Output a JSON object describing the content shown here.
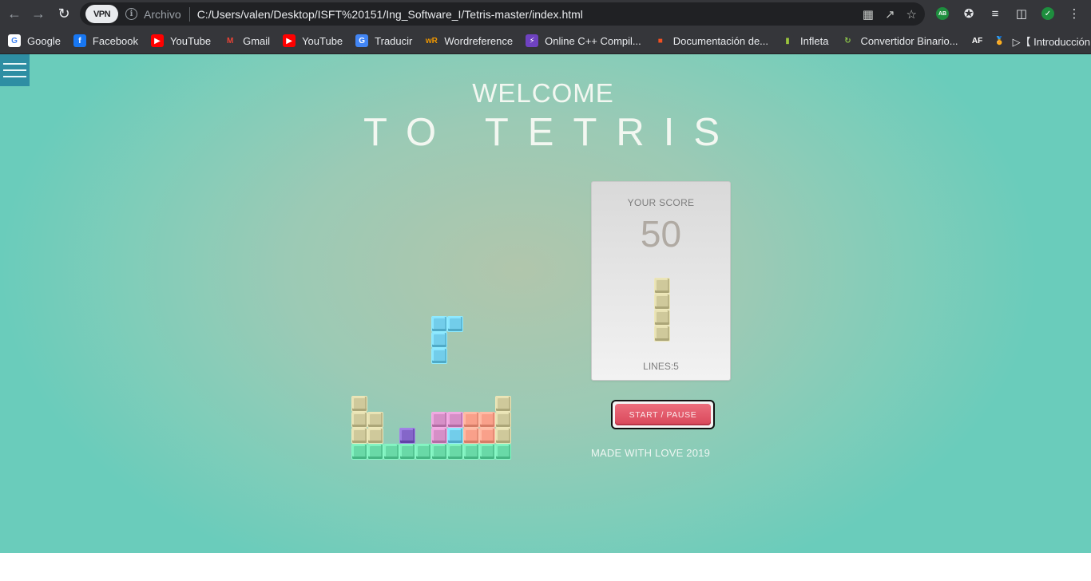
{
  "browser": {
    "vpn_label": "VPN",
    "site_info_label": "Archivo",
    "url": "C:/Users/valen/Desktop/ISFT%20151/Ing_Software_I/Tetris-master/index.html",
    "ext_ab_label": "AB"
  },
  "bookmarks": [
    {
      "label": "Google",
      "icon": "google-icon",
      "color": "#ffffff",
      "glyph": "G",
      "glyph_color": "#4285f4"
    },
    {
      "label": "Facebook",
      "icon": "facebook-icon",
      "color": "#1877f2",
      "glyph": "f",
      "glyph_color": "#ffffff"
    },
    {
      "label": "YouTube",
      "icon": "youtube-icon",
      "color": "#ff0000",
      "glyph": "▶",
      "glyph_color": "#ffffff"
    },
    {
      "label": "Gmail",
      "icon": "gmail-icon",
      "color": "#35363a",
      "glyph": "M",
      "glyph_color": "#ea4335"
    },
    {
      "label": "YouTube",
      "icon": "youtube-icon",
      "color": "#ff0000",
      "glyph": "▶",
      "glyph_color": "#ffffff"
    },
    {
      "label": "Traducir",
      "icon": "translate-icon",
      "color": "#4285f4",
      "glyph": "G",
      "glyph_color": "#ffffff"
    },
    {
      "label": "Wordreference",
      "icon": "wordreference-icon",
      "color": "#35363a",
      "glyph": "wR",
      "glyph_color": "#f29900"
    },
    {
      "label": "Online C++ Compil...",
      "icon": "compiler-icon",
      "color": "#6f42c1",
      "glyph": "⚡",
      "glyph_color": "#ffffff"
    },
    {
      "label": "Documentación de...",
      "icon": "microsoft-icon",
      "color": "#35363a",
      "glyph": "■",
      "glyph_color": "#f25022"
    },
    {
      "label": "Infleta",
      "icon": "infleta-icon",
      "color": "#35363a",
      "glyph": "▮",
      "glyph_color": "#9bc53d"
    },
    {
      "label": "Convertidor Binario...",
      "icon": "converter-icon",
      "color": "#35363a",
      "glyph": "↻",
      "glyph_color": "#8bc34a"
    },
    {
      "label": "",
      "icon": "af-icon",
      "color": "#35363a",
      "glyph": "AF",
      "glyph_color": "#ffffff"
    },
    {
      "label": "▷【 Introducción...",
      "icon": "medal-icon",
      "color": "#35363a",
      "glyph": "🏅",
      "glyph_color": "#f5a623"
    }
  ],
  "page": {
    "welcome": "WELCOME",
    "title": "TO TETRIS",
    "score_label": "YOUR SCORE",
    "score_value": "50",
    "lines_label": "LINES:5",
    "start_button": "START / PAUSE",
    "footer": "MADE WITH LOVE 2019"
  },
  "colors": {
    "khaki": "#cfc99b",
    "cyan": "#72cdea",
    "pink": "#d68fc7",
    "purple": "#8466c9",
    "salmon": "#f9a08a",
    "green": "#69d9a7"
  },
  "board": {
    "columns": 10,
    "rows": 20,
    "falling_piece": {
      "color": "cyan",
      "cells": [
        [
          5,
          15
        ],
        [
          6,
          15
        ],
        [
          5,
          16
        ],
        [
          5,
          17
        ]
      ]
    },
    "settled": [
      {
        "color": "khaki",
        "cells": [
          [
            0,
            20
          ],
          [
            0,
            21
          ],
          [
            1,
            21
          ],
          [
            0,
            22
          ],
          [
            1,
            22
          ],
          [
            9,
            20
          ],
          [
            9,
            21
          ],
          [
            9,
            22
          ]
        ]
      },
      {
        "color": "pink",
        "cells": [
          [
            5,
            21
          ],
          [
            6,
            21
          ],
          [
            3,
            22
          ],
          [
            5,
            22
          ]
        ]
      },
      {
        "color": "salmon",
        "cells": [
          [
            7,
            21
          ],
          [
            8,
            21
          ],
          [
            7,
            22
          ],
          [
            8,
            22
          ]
        ]
      },
      {
        "color": "purple",
        "cells": [
          [
            3,
            22
          ]
        ]
      },
      {
        "color": "cyan",
        "cells": [
          [
            6,
            22
          ]
        ]
      },
      {
        "color": "green",
        "cells": [
          [
            0,
            23
          ],
          [
            1,
            23
          ],
          [
            2,
            23
          ],
          [
            3,
            23
          ],
          [
            4,
            23
          ],
          [
            5,
            23
          ],
          [
            6,
            23
          ],
          [
            7,
            23
          ],
          [
            8,
            23
          ],
          [
            9,
            23
          ]
        ]
      }
    ],
    "next_piece": {
      "color": "khaki",
      "cells": [
        [
          0,
          0
        ],
        [
          0,
          1
        ],
        [
          0,
          2
        ],
        [
          0,
          3
        ]
      ]
    }
  }
}
